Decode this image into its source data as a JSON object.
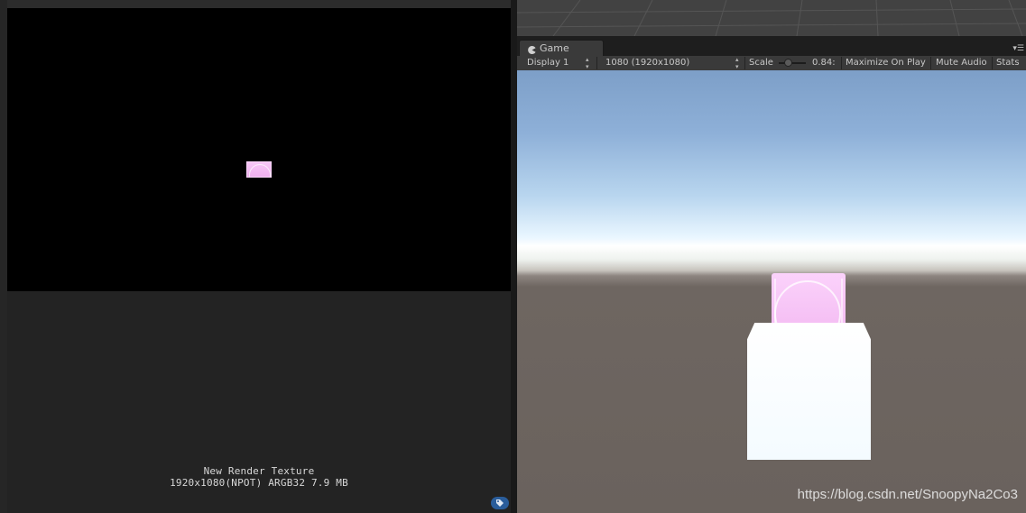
{
  "texture_preview": {
    "name": "New Render Texture",
    "details": "1920x1080(NPOT)  ARGB32  7.9 MB",
    "tag_icon": "asset-label-icon"
  },
  "game_window": {
    "tab_label": "Game",
    "tab_icon": "pacman-game-icon",
    "toolbar": {
      "display": "Display 1",
      "resolution": "1080 (1920x1080)",
      "scale_label": "Scale",
      "scale_value": "0.84:",
      "maximize_on_play": "Maximize On Play",
      "mute_audio": "Mute Audio",
      "stats": "Stats"
    }
  },
  "watermark": "https://blog.csdn.net/SnoopyNa2Co3",
  "colors": {
    "panel_bg": "#232323",
    "preview_bg": "#000000",
    "toolbar_bg": "#3a3a3a",
    "sky_top": "#7d9fc8",
    "horizon": "#ffffff",
    "ground": "#6a625d",
    "pink_texture": "#f7c7f7",
    "tag_blue": "#2a5d9b"
  }
}
